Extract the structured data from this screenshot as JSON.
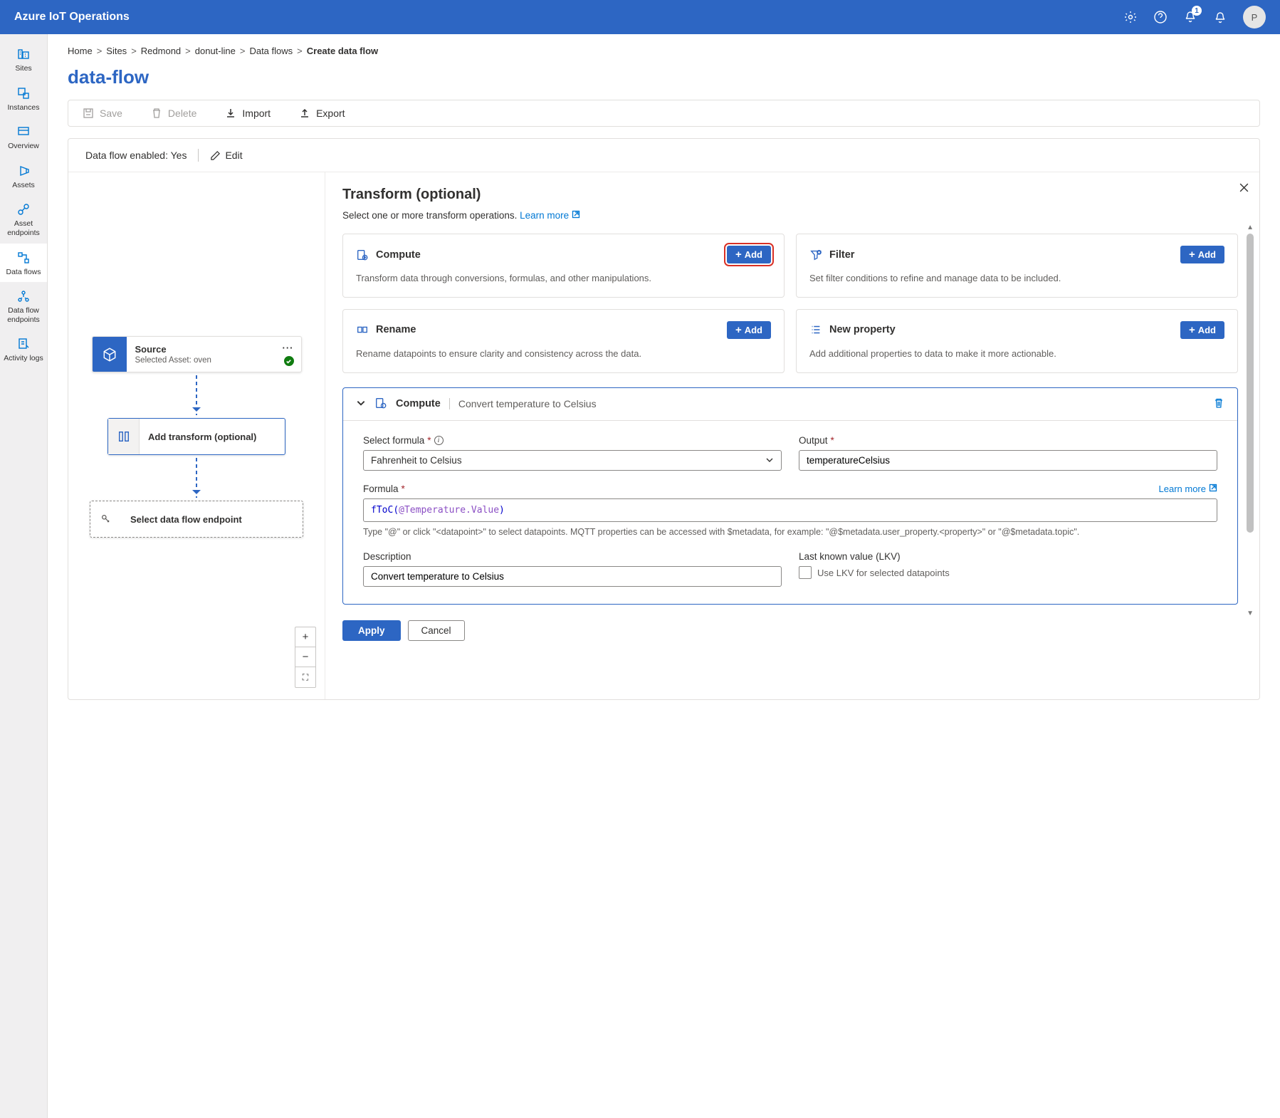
{
  "topbar": {
    "title": "Azure IoT Operations",
    "notification_count": "1",
    "avatar_initial": "P"
  },
  "sidebar": {
    "items": [
      {
        "label": "Sites"
      },
      {
        "label": "Instances"
      },
      {
        "label": "Overview"
      },
      {
        "label": "Assets"
      },
      {
        "label": "Asset endpoints"
      },
      {
        "label": "Data flows"
      },
      {
        "label": "Data flow endpoints"
      },
      {
        "label": "Activity logs"
      }
    ]
  },
  "breadcrumb": {
    "items": [
      "Home",
      "Sites",
      "Redmond",
      "donut-line",
      "Data flows"
    ],
    "current": "Create data flow"
  },
  "page": {
    "title": "data-flow"
  },
  "toolbar": {
    "save": "Save",
    "delete": "Delete",
    "import": "Import",
    "export": "Export"
  },
  "card": {
    "status_label": "Data flow enabled: ",
    "status_value": "Yes",
    "edit": "Edit"
  },
  "flow": {
    "source": {
      "title": "Source",
      "subtitle": "Selected Asset: oven"
    },
    "transform": {
      "label": "Add transform (optional)"
    },
    "endpoint": {
      "label": "Select data flow endpoint"
    }
  },
  "panel": {
    "title": "Transform (optional)",
    "desc": "Select one or more transform operations. ",
    "learn_more": "Learn more",
    "ops": {
      "compute": {
        "title": "Compute",
        "desc": "Transform data through conversions, formulas, and other manipulations.",
        "add": "Add"
      },
      "filter": {
        "title": "Filter",
        "desc": "Set filter conditions to refine and manage data to be included.",
        "add": "Add"
      },
      "rename": {
        "title": "Rename",
        "desc": "Rename datapoints to ensure clarity and consistency across the data.",
        "add": "Add"
      },
      "newprop": {
        "title": "New property",
        "desc": "Add additional properties to data to make it more actionable.",
        "add": "Add"
      }
    },
    "compute_form": {
      "head_title": "Compute",
      "head_sub": "Convert temperature to Celsius",
      "select_formula_label": "Select formula",
      "select_formula_value": "Fahrenheit to Celsius",
      "output_label": "Output",
      "output_value": "temperatureCelsius",
      "formula_label": "Formula",
      "formula_learn": "Learn more",
      "formula_fn": "fToC",
      "formula_arg": "@Temperature.Value",
      "formula_hint": "Type \"@\" or click \"<datapoint>\" to select datapoints. MQTT properties can be accessed with $metadata, for example: \"@$metadata.user_property.<property>\" or \"@$metadata.topic\".",
      "description_label": "Description",
      "description_value": "Convert temperature to Celsius",
      "lkv_label": "Last known value (LKV)",
      "lkv_checkbox": "Use LKV for selected datapoints"
    },
    "apply": "Apply",
    "cancel": "Cancel"
  }
}
